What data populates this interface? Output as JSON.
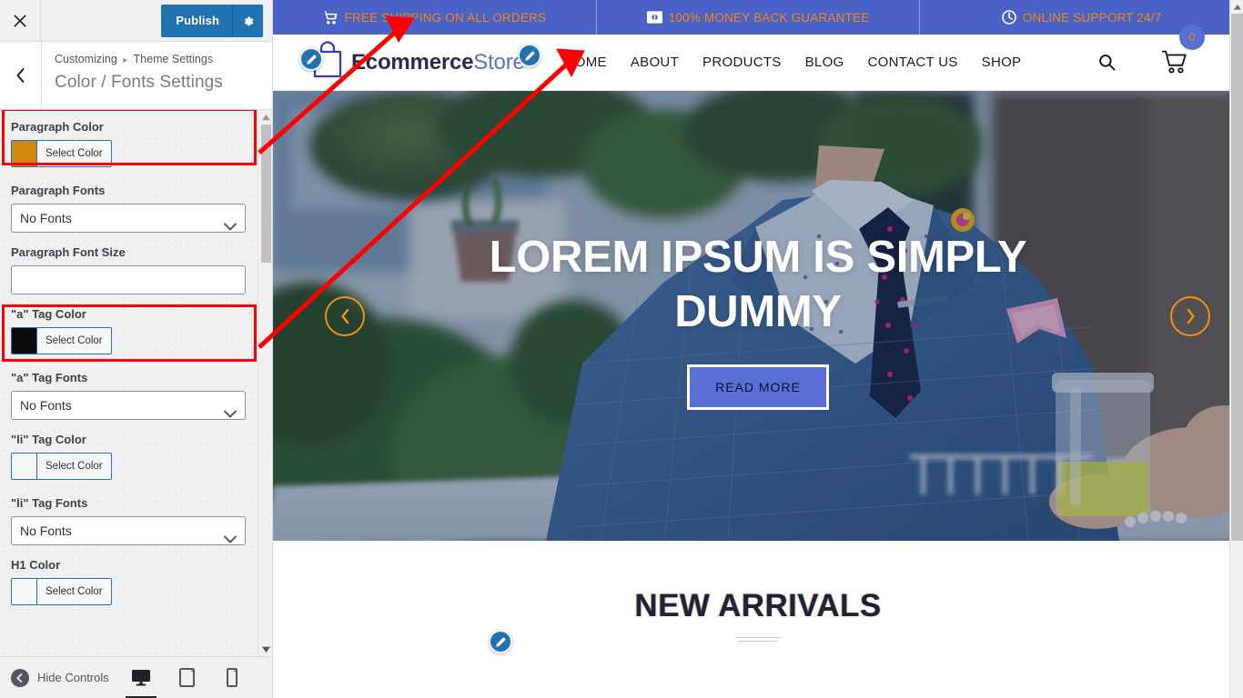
{
  "customizer": {
    "close_icon": "close-x-icon",
    "publish_label": "Publish",
    "gear_icon": "gear-icon",
    "back_icon": "chevron-left-icon",
    "breadcrumb_root": "Customizing",
    "breadcrumb_sep": "▸",
    "breadcrumb_section": "Theme Settings",
    "panel_title": "Color / Fonts Settings",
    "select_color_label": "Select Color",
    "controls": [
      {
        "id": "paragraph-color",
        "label": "Paragraph Color",
        "type": "color",
        "value": "#d1880f",
        "button": "Select Color",
        "highlighted": true
      },
      {
        "id": "paragraph-fonts",
        "label": "Paragraph Fonts",
        "type": "select",
        "value": "No Fonts",
        "highlighted": false
      },
      {
        "id": "paragraph-font-size",
        "label": "Paragraph Font Size",
        "type": "text",
        "value": "",
        "highlighted": false
      },
      {
        "id": "a-tag-color",
        "label": "\"a\" Tag Color",
        "type": "color",
        "value": "#0b0b0b",
        "button": "Select Color",
        "highlighted": true
      },
      {
        "id": "a-tag-fonts",
        "label": "\"a\" Tag Fonts",
        "type": "select",
        "value": "No Fonts",
        "highlighted": false
      },
      {
        "id": "li-tag-color",
        "label": "\"li\" Tag Color",
        "type": "color",
        "value": "#f6f7f7",
        "button": "Select Color",
        "highlighted": false
      },
      {
        "id": "li-tag-fonts",
        "label": "\"li\" Tag Fonts",
        "type": "select",
        "value": "No Fonts",
        "highlighted": false
      },
      {
        "id": "h1-color",
        "label": "H1 Color",
        "type": "color",
        "value": "#f6f7f7",
        "button": "Select Color",
        "highlighted": false
      }
    ],
    "footer": {
      "hide_controls_label": "Hide Controls",
      "devices": [
        {
          "name": "desktop",
          "icon": "desktop-icon",
          "active": true
        },
        {
          "name": "tablet",
          "icon": "tablet-icon",
          "active": false
        },
        {
          "name": "mobile",
          "icon": "mobile-icon",
          "active": false
        }
      ]
    }
  },
  "preview": {
    "promo_bar": [
      {
        "icon": "shopping-cart-icon",
        "text": "FREE SHIPPING ON ALL ORDERS"
      },
      {
        "icon": "money-icon",
        "text": "100% MONEY BACK GUARANTEE"
      },
      {
        "icon": "clock-icon",
        "text": "ONLINE SUPPORT 24/7"
      }
    ],
    "brand": {
      "icon": "shopping-bag-icon",
      "name_primary": "Ecommerce",
      "name_accent": "Store"
    },
    "nav_items": [
      "HOME",
      "ABOUT",
      "PRODUCTS",
      "BLOG",
      "CONTACT US",
      "SHOP"
    ],
    "nav_icons": {
      "search": "search-icon",
      "cart": "cart-icon"
    },
    "cart_count": "0",
    "hero": {
      "title": "LOREM IPSUM IS SIMPLY DUMMY",
      "button": "READ MORE",
      "prev_icon": "chevron-left-icon",
      "next_icon": "chevron-right-icon"
    },
    "section": {
      "heading": "NEW ARRIVALS"
    }
  },
  "colors": {
    "promo_bg": "#4a62c6",
    "promo_text": "#f0871a",
    "brand_accent": "#5a6fd6",
    "publish_bg": "#2271b1",
    "arrow_orange": "#f0920a",
    "annotation_red": "#ff0000"
  }
}
